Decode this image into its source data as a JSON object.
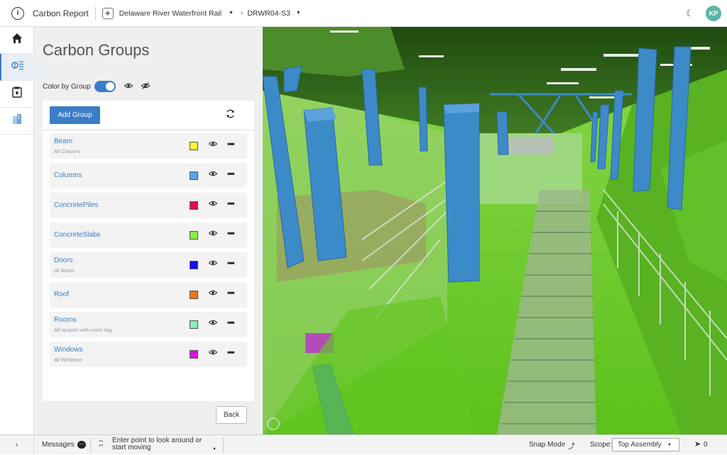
{
  "topbar": {
    "app_icon": "info-circle-icon",
    "app_title": "Carbon Report",
    "project_name": "Delaware River Waterfront Rail",
    "model_name": "DRWR04-S3",
    "theme_icon": "moon-icon",
    "user_initials": "KP"
  },
  "rail": {
    "items": [
      {
        "icon": "home-icon",
        "glyph": "⌂"
      },
      {
        "icon": "carbon-groups-icon",
        "glyph": "⊘"
      },
      {
        "icon": "clipboard-icon",
        "glyph": "📋"
      },
      {
        "icon": "buildings-icon",
        "glyph": "▥"
      }
    ]
  },
  "panel": {
    "title": "Carbon Groups",
    "color_by_group_label": "Color by Group",
    "color_by_group_on": true,
    "add_group_label": "Add Group",
    "back_label": "Back",
    "groups": [
      {
        "name": "Beam",
        "subtitle": "All Classes",
        "color": "#ffff33"
      },
      {
        "name": "Columns",
        "subtitle": "",
        "color": "#5aa4e8"
      },
      {
        "name": "ConcretePiles",
        "subtitle": "",
        "color": "#dd1155"
      },
      {
        "name": "ConcreteSlabs",
        "subtitle": "",
        "color": "#88ee44"
      },
      {
        "name": "Doors",
        "subtitle": "all doors",
        "color": "#1111ee"
      },
      {
        "name": "Roof",
        "subtitle": "",
        "color": "#e87722"
      },
      {
        "name": "Rooms",
        "subtitle": "All spaces with room tag",
        "color": "#88eebb"
      },
      {
        "name": "Windows",
        "subtitle": "all Windows",
        "color": "#dd11dd"
      }
    ]
  },
  "statusbar": {
    "messages_label": "Messages",
    "hint_text": "Enter point to look around or start moving",
    "snap_mode_label": "Snap Mode",
    "scope_label": "Scope:",
    "scope_value": "Top Assembly",
    "selection_count": "0"
  },
  "viewport": {
    "floor_color": "#6fcf2a",
    "column_color": "#3d8ac8",
    "ceiling_color": "#2b5a18"
  }
}
